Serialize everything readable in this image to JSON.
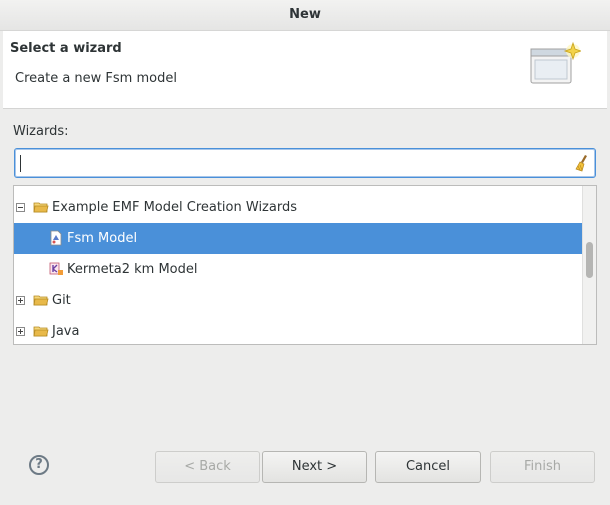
{
  "window": {
    "title": "New"
  },
  "banner": {
    "title": "Select a wizard",
    "description": "Create a new Fsm model",
    "icon": "new-wizard-icon"
  },
  "wizards": {
    "label": "Wizards:",
    "filter": {
      "value": "",
      "placeholder": "",
      "clear_icon": "clear-broom-icon"
    },
    "tree": [
      {
        "label": "Example EMF Model Creation Wizards",
        "type": "folder",
        "expanded": true,
        "level": 0
      },
      {
        "label": "Fsm Model",
        "type": "model",
        "selected": true,
        "level": 1
      },
      {
        "label": "Kermeta2 km Model",
        "type": "kermeta-model",
        "selected": false,
        "level": 1
      },
      {
        "label": "Git",
        "type": "folder",
        "expanded": false,
        "level": 0
      },
      {
        "label": "Java",
        "type": "folder",
        "expanded": false,
        "level": 0
      }
    ]
  },
  "buttons": {
    "help": "?",
    "back": "< Back",
    "next": "Next >",
    "cancel": "Cancel",
    "finish": "Finish"
  },
  "colors": {
    "selection": "#4a90d9",
    "folder": "#e8c35a"
  }
}
